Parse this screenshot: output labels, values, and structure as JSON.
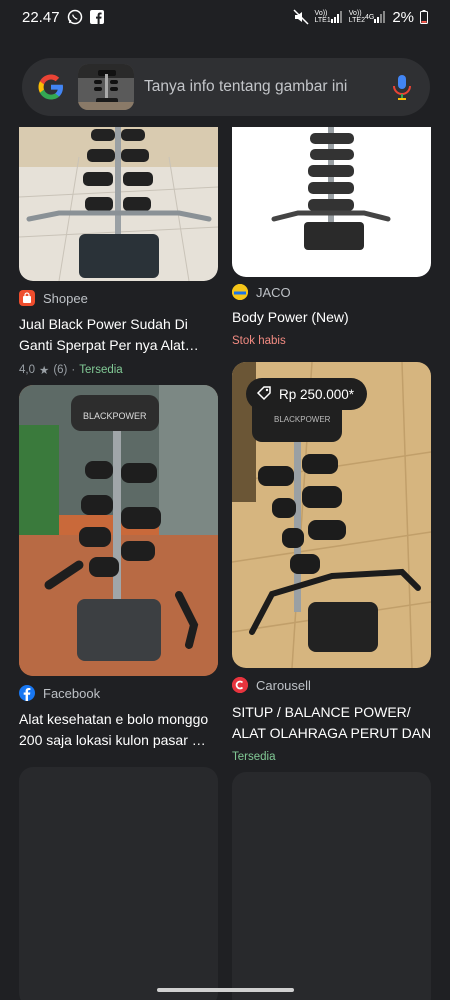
{
  "status_bar": {
    "time": "22.47",
    "battery": "2%",
    "net1": "Vo))\nLTE1",
    "net2": "Vo))\nLTE2",
    "net3": "4G"
  },
  "search": {
    "placeholder": "Tanya info tentang gambar ini"
  },
  "results": [
    {
      "source": "Shopee",
      "title": "Jual Black Power Sudah Di Ganti Sperpat Per nya Alat…",
      "rating": "4,0",
      "reviews": "(6)",
      "availability": "Tersedia"
    },
    {
      "source": "JACO",
      "title": "Body Power (New)",
      "stock": "Stok habis"
    },
    {
      "source": "Facebook",
      "title_line1": "Alat kesehatan e bolo monggo",
      "title_line2": "200 saja lokasi kulon pasar …"
    },
    {
      "source": "Carousell",
      "price": "Rp 250.000*",
      "title_line1": "SITUP / BALANCE POWER/",
      "title_line2": "ALAT OLAHRAGA PERUT DAN…",
      "availability": "Tersedia"
    }
  ],
  "colors": {
    "background": "#1f2023",
    "search_bg": "#2f3033",
    "green": "#81c995",
    "red": "#f28b82"
  }
}
